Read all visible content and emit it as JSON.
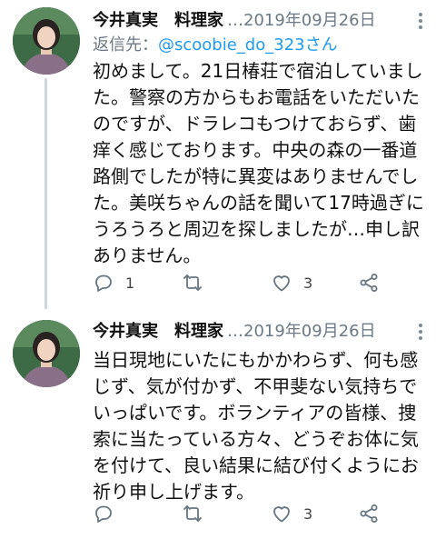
{
  "tweets": [
    {
      "author": "今井真実　料理家",
      "meta": "…2019年09月26日",
      "reply_prefix": "返信先：",
      "reply_handle": "@scoobie_do_323さん",
      "lines": [
        "初めまして。21日椿荘で宿泊していまし",
        "た。警察の方からもお電話をいただいた",
        "のですが、ドラレコもつけておらず、歯",
        "痒く感じております。中央の森の一番道",
        "路側でしたが特に異変はありませんでし",
        "た。美咲ちゃんの話を聞いて17時過ぎに",
        "うろうろと周辺を探しましたが…申し訳",
        "ありません。"
      ],
      "reply_count": "1",
      "retweet_count": "",
      "like_count": "3"
    },
    {
      "author": "今井真実　料理家",
      "meta": "…2019年09月26日",
      "lines": [
        "当日現地にいたにもかかわらず、何も感",
        "じず、気が付かず、不甲斐ない気持ちで",
        "いっぱいです。ボランティアの皆様、捜",
        "索に当たっている方々、どうぞお体に気",
        "を付けて、良い結果に結び付くようにお",
        "祈り申し上げます。"
      ],
      "reply_count": "",
      "retweet_count": "",
      "like_count": "3"
    }
  ],
  "icons": {
    "reply": "reply-icon",
    "retweet": "retweet-icon",
    "like": "heart-icon",
    "share": "share-icon",
    "more": "more-vertical-icon"
  },
  "colors": {
    "text": "#111111",
    "muted": "#6b7a86",
    "link": "#1d9bf0",
    "thread_line": "#cfd6dc"
  }
}
